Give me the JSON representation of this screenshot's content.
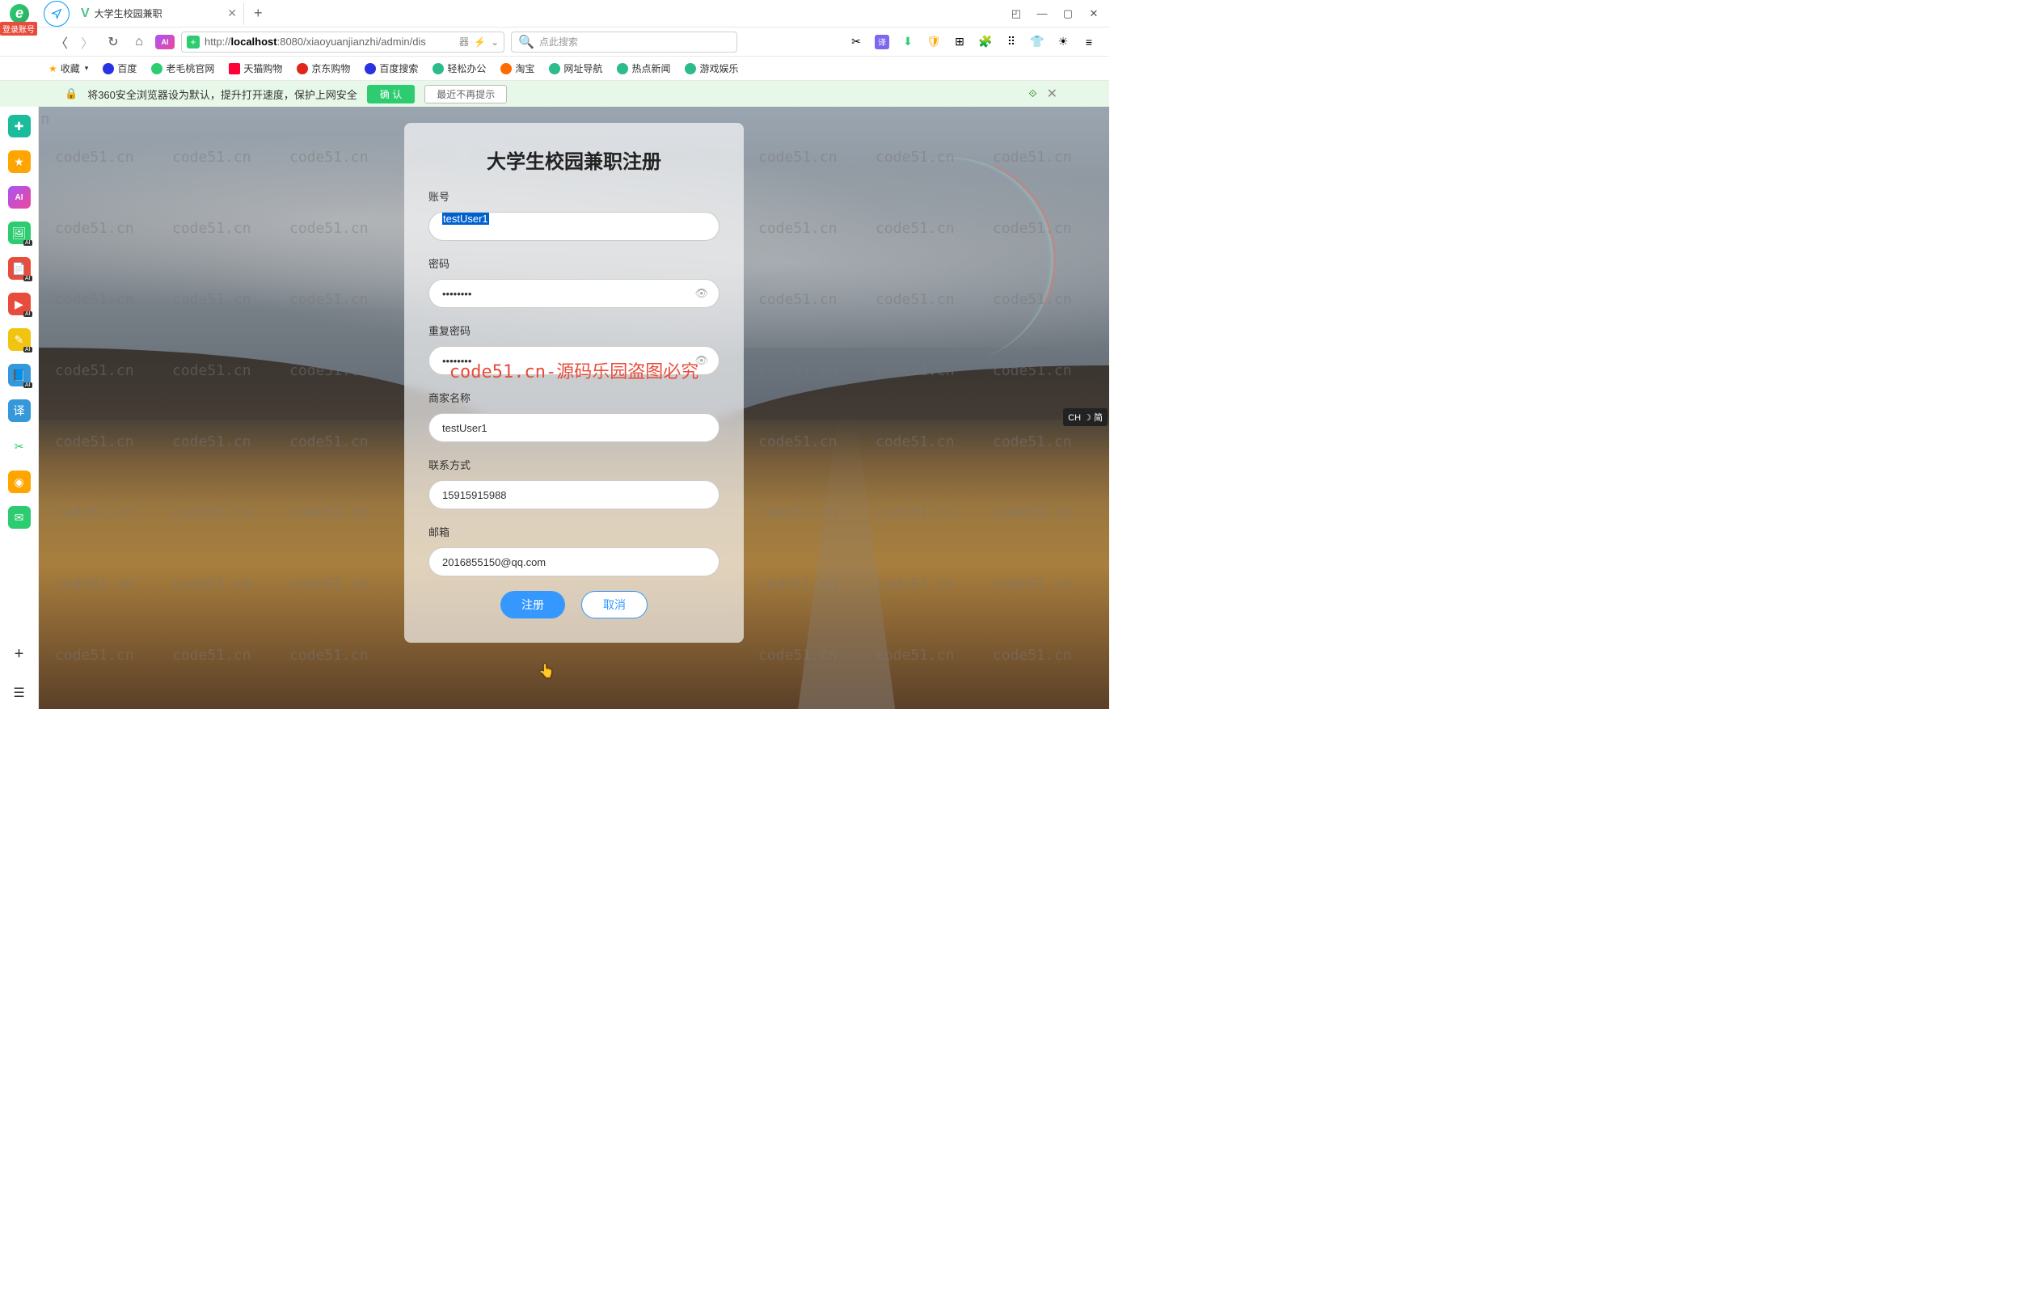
{
  "browser": {
    "login_badge": "登录账号",
    "tab": {
      "icon": "V",
      "title": "大学生校园兼职"
    },
    "url_prefix": "http://",
    "url_host": "localhost",
    "url_rest": ":8080/xiaoyuanjianzhi/admin/dis",
    "url_action1": "器",
    "url_action2": "译",
    "search_placeholder": "点此搜索"
  },
  "bookmarks": {
    "label": "收藏",
    "items": [
      "百度",
      "老毛桃官网",
      "天猫购物",
      "京东购物",
      "百度搜索",
      "轻松办公",
      "淘宝",
      "网址导航",
      "热点新闻",
      "游戏娱乐"
    ]
  },
  "banner": {
    "text": "将360安全浏览器设为默认，提升打开速度，保护上网安全",
    "confirm": "确 认",
    "later": "最近不再提示"
  },
  "watermark_text": "code51.cn",
  "red_watermark": "code51.cn-源码乐园盗图必究",
  "form": {
    "title": "大学生校园兼职注册",
    "username_label": "账号",
    "username_value": "testUser1",
    "password_label": "密码",
    "password_value": "••••••••",
    "repeat_label": "重复密码",
    "repeat_value": "••••••••",
    "merchant_label": "商家名称",
    "merchant_value": "testUser1",
    "contact_label": "联系方式",
    "contact_value": "15915915988",
    "email_label": "邮箱",
    "email_value": "2016855150@qq.com",
    "submit": "注册",
    "cancel": "取消"
  },
  "ime": "CH ☽ 简"
}
